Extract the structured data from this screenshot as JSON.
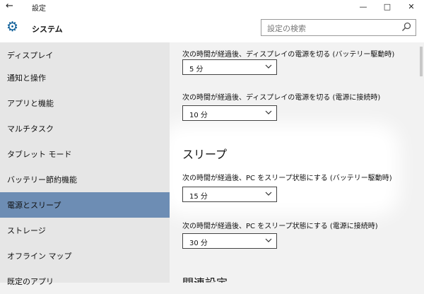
{
  "titlebar": {
    "back_icon": "back-arrow-icon",
    "title": "設定",
    "minimize": "—",
    "maximize": "□",
    "close": "✕"
  },
  "header": {
    "icon": "gear-icon",
    "app_title": "システム",
    "search": {
      "placeholder": "設定の検索",
      "icon": "search-icon"
    }
  },
  "sidebar": {
    "items": [
      {
        "label": "ディスプレイ"
      },
      {
        "label": "通知と操作"
      },
      {
        "label": "アプリと機能"
      },
      {
        "label": "マルチタスク"
      },
      {
        "label": "タブレット モード"
      },
      {
        "label": "バッテリー節約機能"
      },
      {
        "label": "電源とスリープ",
        "selected": true
      },
      {
        "label": "ストレージ"
      },
      {
        "label": "オフライン マップ"
      },
      {
        "label": "既定のアプリ"
      }
    ],
    "selected_color": "#6d8db4"
  },
  "main": {
    "screen_battery_label": "次の時間が経過後、ディスプレイの電源を切る (バッテリー駆動時)",
    "screen_battery_value": "5 分",
    "screen_plugged_label": "次の時間が経過後、ディスプレイの電源を切る (電源に接続時)",
    "screen_plugged_value": "10 分",
    "sleep_title": "スリープ",
    "sleep_battery_label": "次の時間が経過後、PC をスリープ状態にする (バッテリー駆動時)",
    "sleep_battery_value": "15 分",
    "sleep_plugged_label": "次の時間が経過後、PC をスリープ状態にする (電源に接続時)",
    "sleep_plugged_value": "30 分",
    "related_title": "関連設定"
  }
}
